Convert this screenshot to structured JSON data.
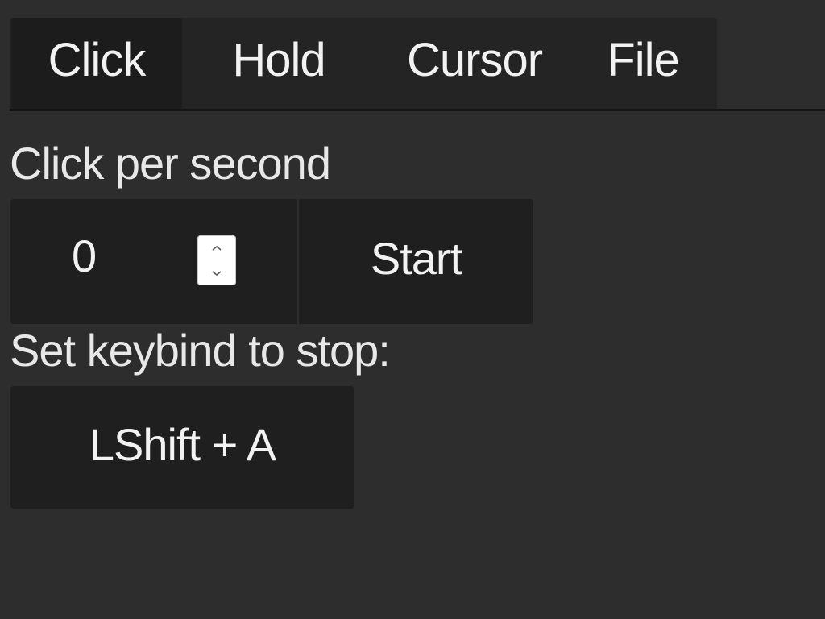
{
  "tabs": [
    {
      "label": "Click",
      "active": true
    },
    {
      "label": "Hold",
      "active": false
    },
    {
      "label": "Cursor",
      "active": false
    },
    {
      "label": "File",
      "active": false
    }
  ],
  "click_panel": {
    "cps_label": "Click per second",
    "cps_value": "0",
    "start_label": "Start",
    "keybind_label": "Set keybind to stop:",
    "keybind_value": "LShift + A"
  },
  "icons": {
    "spinner_up": "triangle-up-icon",
    "spinner_down": "triangle-down-icon"
  },
  "colors": {
    "background": "#2d2d2d",
    "surface": "#1f1f1f",
    "tab_active": "#1c1c1c",
    "text": "#f2f2f2"
  }
}
